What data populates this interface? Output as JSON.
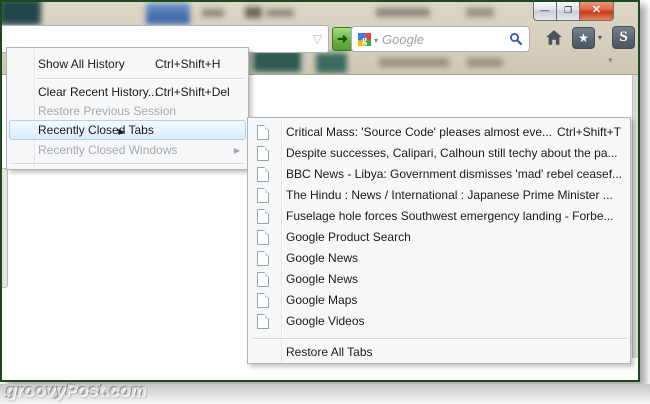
{
  "icons": {
    "minimize": "—",
    "maximize": "❐",
    "close": "✕",
    "url_history_dropdown": "▽",
    "go_arrow": "➜",
    "engine_caret": "▾",
    "bookmark_caret": "▾",
    "overflow_caret": "▾",
    "bookmark_star": "★",
    "addon_s": "S",
    "submenu_arrow": "▶"
  },
  "navbar": {
    "search_placeholder": "Google"
  },
  "history_menu": {
    "show_all_history": {
      "label": "Show All History",
      "shortcut": "Ctrl+Shift+H"
    },
    "clear_recent_history": {
      "label": "Clear Recent History...",
      "shortcut": "Ctrl+Shift+Del"
    },
    "restore_previous_session": {
      "label": "Restore Previous Session"
    },
    "recently_closed_tabs": {
      "label": "Recently Closed Tabs"
    },
    "recently_closed_windows": {
      "label": "Recently Closed Windows"
    }
  },
  "submenu": {
    "items": [
      {
        "title": "Critical Mass: 'Source Code' pleases almost eve...",
        "shortcut": "Ctrl+Shift+T"
      },
      {
        "title": "Despite successes, Calipari, Calhoun still techy about the pa..."
      },
      {
        "title": "BBC News - Libya: Government dismisses 'mad' rebel ceasef..."
      },
      {
        "title": "The Hindu : News / International : Japanese Prime Minister ..."
      },
      {
        "title": "Fuselage hole forces Southwest emergency landing - Forbe..."
      },
      {
        "title": "Google Product Search"
      },
      {
        "title": "Google News"
      },
      {
        "title": "Google News"
      },
      {
        "title": "Google Maps"
      },
      {
        "title": "Google Videos"
      }
    ],
    "restore_all_label": "Restore All Tabs"
  },
  "watermark": "groovyPost.com",
  "colors": {
    "frame_border": "#1c4a20",
    "chrome_beige": "#d6cfbe",
    "menu_highlight_border": "#aed0f3",
    "menu_highlight_fill": "#dcebfc",
    "go_button_green": "#6db344",
    "close_button_red": "#c23a1c",
    "search_magnifier_blue": "#2f5bb7",
    "active_tab_blue": "#2e5b9e"
  }
}
